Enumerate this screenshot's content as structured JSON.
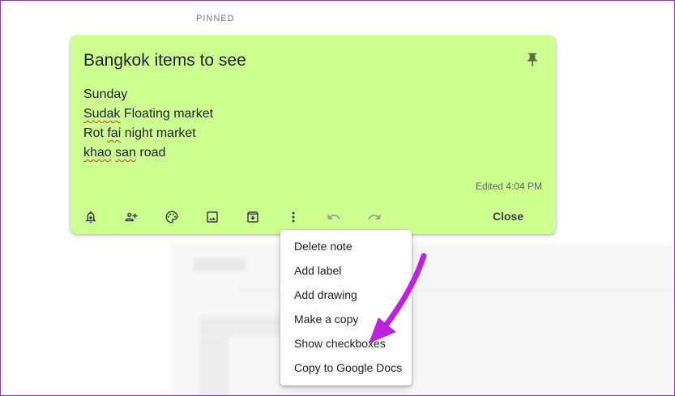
{
  "section": {
    "pinned_label": "PINNED"
  },
  "note": {
    "title": "Bangkok items to see",
    "lines": [
      {
        "parts": [
          "Sunday"
        ]
      },
      {
        "parts": [
          "Sudak",
          " Floating market"
        ]
      },
      {
        "parts": [
          "Rot ",
          "fai",
          " night market"
        ]
      },
      {
        "parts": [
          "khao",
          " ",
          "san",
          " road"
        ]
      }
    ],
    "edited": "Edited 4:04 PM",
    "background_color": "#ccff90",
    "toolbar": {
      "icons": [
        "remind-me-icon",
        "collaborator-icon",
        "palette-icon",
        "add-image-icon",
        "archive-icon",
        "more-vert-icon",
        "undo-icon",
        "redo-icon"
      ],
      "close_label": "Close"
    }
  },
  "more_menu": {
    "items": [
      "Delete note",
      "Add label",
      "Add drawing",
      "Make a copy",
      "Show checkboxes",
      "Copy to Google Docs"
    ]
  },
  "annotation": {
    "arrow_color": "#c020e0",
    "points_to": "Show checkboxes"
  }
}
